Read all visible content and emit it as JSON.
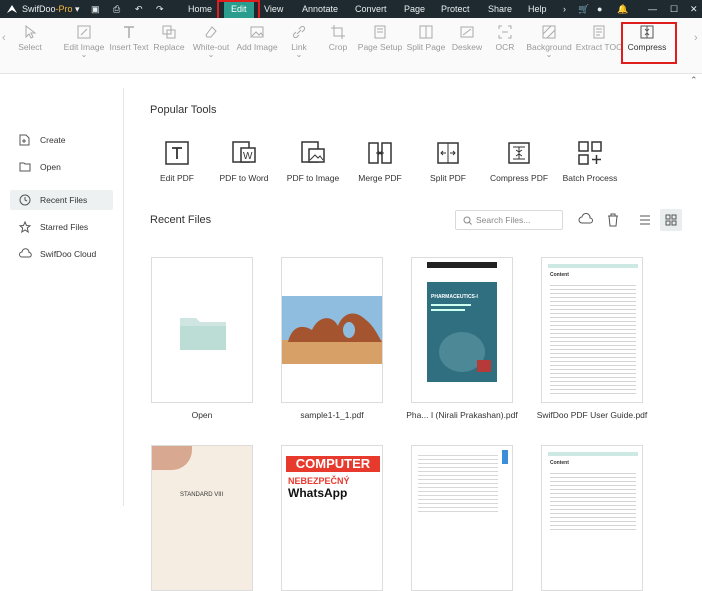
{
  "titlebar": {
    "app_name": "SwifDoo",
    "app_suffix": "-Pro",
    "menu": [
      "Home",
      "Edit",
      "View",
      "Annotate",
      "Convert",
      "Page",
      "Protect",
      "Share",
      "Help"
    ]
  },
  "ribbon": {
    "tools": [
      "Select",
      "Edit Image",
      "Insert Text",
      "Replace",
      "White-out",
      "Add Image",
      "Link",
      "Crop",
      "Page Setup",
      "Split Page",
      "Deskew",
      "OCR",
      "Background",
      "Extract TOC",
      "Compress"
    ]
  },
  "sidebar": {
    "items": [
      "Create",
      "Open",
      "Recent Files",
      "Starred Files",
      "SwifDoo Cloud"
    ]
  },
  "main": {
    "popular_title": "Popular Tools",
    "popular_tools": [
      "Edit PDF",
      "PDF to Word",
      "PDF to Image",
      "Merge PDF",
      "Split PDF",
      "Compress PDF",
      "Batch Process"
    ],
    "recent_title": "Recent Files",
    "search_placeholder": "Search Files...",
    "files": [
      "Open",
      "sample1-1_1.pdf",
      "Pha... I (Nirali Prakashan).pdf",
      "SwifDoo PDF User Guide.pdf"
    ],
    "book_title": "PHARMACEUTICS-I",
    "doc_heading": "Content",
    "mag_title": "COMPUTER",
    "mag_line1": "NEBEZPEČNÝ",
    "mag_line2": "WhatsApp",
    "card5_text": "STANDARD VIII"
  },
  "colors": {
    "titlebar": "#1f2a30",
    "accent": "#2a9d8f",
    "highlight": "#e01d1d"
  }
}
